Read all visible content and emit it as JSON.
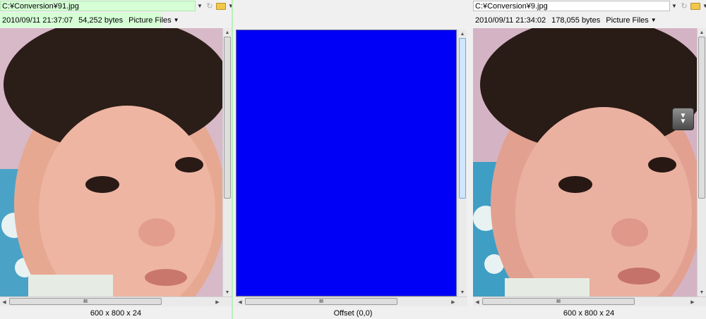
{
  "left_pane": {
    "path": "C:¥Conversion¥91.jpg",
    "info": {
      "date": "2010/09/11 21:37:07",
      "size": "54,252 bytes",
      "file_type": "Picture Files"
    },
    "status": "600 x 800 x 24"
  },
  "middle_pane": {
    "status": "Offset (0,0)",
    "diff_color": "#0000f6"
  },
  "right_pane": {
    "path": "C:¥Conversion¥9.jpg",
    "info": {
      "date": "2010/09/11 21:34:02",
      "size": "178,055 bytes",
      "file_type": "Picture Files"
    },
    "status": "600 x 800 x 24"
  },
  "scroll_glyph": "III",
  "icons": {
    "dropdown": "chevron-down-icon",
    "reload": "refresh-icon",
    "open": "folder-open-icon",
    "sync": "double-chevron-down-icon"
  },
  "colors": {
    "active_pane_tint": "#d6ffd6",
    "diff_blue": "#0000f6"
  }
}
